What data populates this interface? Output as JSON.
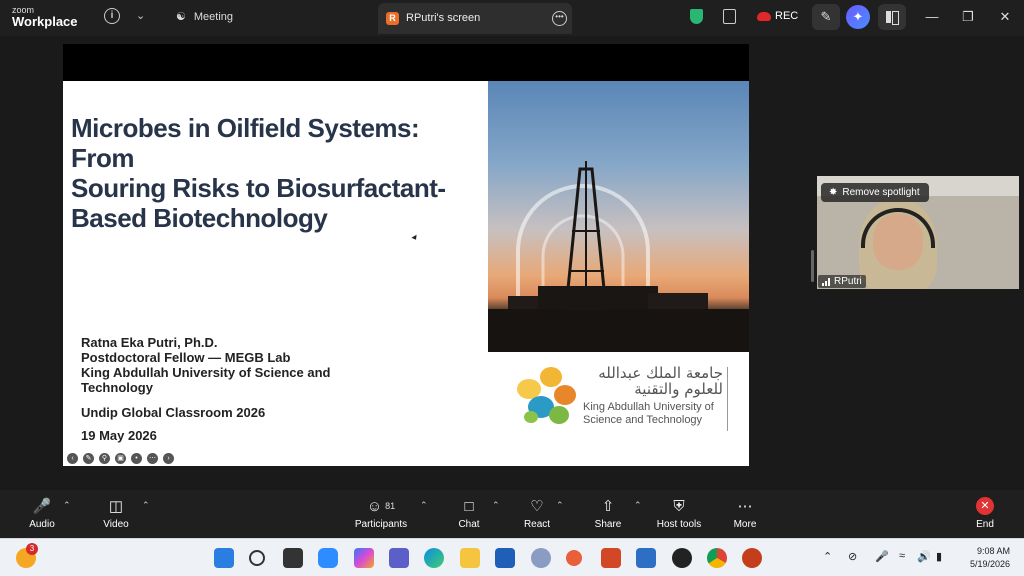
{
  "app": {
    "logo_top": "zoom",
    "logo_bottom": "Workplace"
  },
  "titlebar": {
    "meeting_tab": "Meeting",
    "screen_tab": "RPutri's screen",
    "screen_tab_initial": "R",
    "rec_label": "REC"
  },
  "slide": {
    "title_lines": [
      "Microbes in Oilfield Systems: From",
      "Souring Risks to Biosurfactant-",
      "Based Biotechnology"
    ],
    "author_lines": [
      "Ratna Eka Putri, Ph.D.",
      "Postdoctoral Fellow — MEGB Lab",
      "King Abdullah University of Science and",
      "Technology"
    ],
    "classroom": "Undip Global Classroom 2026",
    "date": "19 May 2026",
    "logo_arabic": "جامعة الملك عبدالله للعلوم والتقنية",
    "logo_english_1": "King Abdullah University of",
    "logo_english_2": "Science and Technology"
  },
  "video": {
    "remove_spotlight": "Remove spotlight",
    "participant_name": "RPutri"
  },
  "toolbar": {
    "audio": "Audio",
    "video": "Video",
    "participants": "Participants",
    "participants_count": "81",
    "chat": "Chat",
    "react": "React",
    "share": "Share",
    "host_tools": "Host tools",
    "more": "More",
    "end": "End"
  },
  "taskbar": {
    "notification_count": "3",
    "time": "9:08 AM",
    "date": "5/19/2026"
  }
}
